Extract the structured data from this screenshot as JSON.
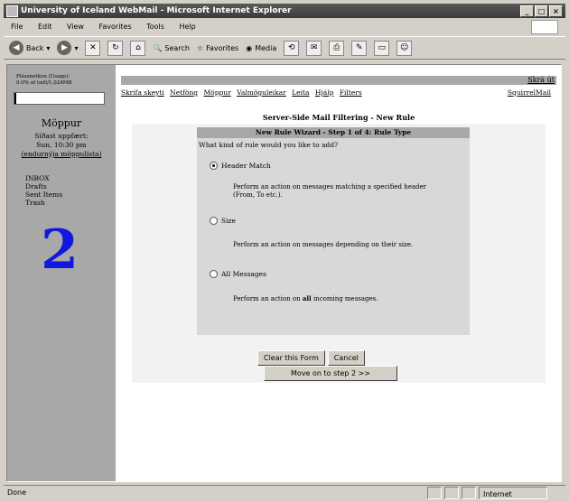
{
  "window": {
    "title": "University of Iceland WebMail - Microsoft Internet Explorer",
    "controls": [
      "_",
      "□",
      "×"
    ]
  },
  "menu": [
    "File",
    "Edit",
    "View",
    "Favorites",
    "Tools",
    "Help"
  ],
  "toolbar": {
    "back": "Back",
    "forward": "",
    "search": "Search",
    "favorites": "Favorites",
    "media": "Media"
  },
  "sidebar": {
    "usage_label": "Plássnotkun (Usage):",
    "usage_value": "0.0% of (nd)/1,024MB",
    "folder_title": "Möppur",
    "last_update_label": "Síðast uppfært:",
    "last_update_value": "Sun, 10:30 pm",
    "refresh_link": "(endurnýja möppulista)",
    "folders": [
      "INBOX",
      "Drafts",
      "Sent Items",
      "Trash"
    ],
    "annotation": "2"
  },
  "top": {
    "signout": "Skrá út",
    "nav": [
      "Skrifa skeyti",
      "Netföng",
      "Möppur",
      "Valmöguleikar",
      "Leita",
      "Hjálp",
      "Filters"
    ],
    "brand_link": "SquirrelMail"
  },
  "panel": {
    "title": "Server-Side Mail Filtering - New Rule",
    "wizard_title": "New Rule Wizard - Step 1 of 4: Rule Type",
    "question": "What kind of rule would you like to add?",
    "options": [
      {
        "label": "Header Match",
        "selected": true,
        "desc": "Perform an action on messages matching a specified header (From, To etc.)."
      },
      {
        "label": "Size",
        "selected": false,
        "desc": "Perform an action on messages depending on their size."
      },
      {
        "label": "All Messages",
        "selected": false,
        "desc_pre": "Perform an action on ",
        "desc_bold": "all",
        "desc_post": " incoming messages."
      }
    ],
    "buttons": {
      "clear": "Clear this Form",
      "cancel": "Cancel",
      "next": "Move on to step 2 >>"
    }
  },
  "statusbar": {
    "text": "Done",
    "zone": "Internet"
  }
}
